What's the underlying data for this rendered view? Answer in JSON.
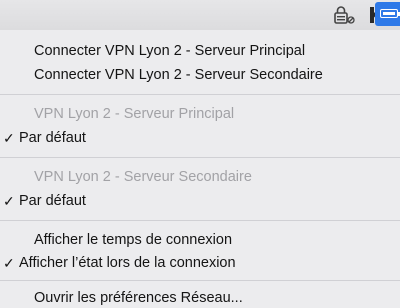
{
  "menubar": {
    "icons": [
      "vpn-lock-icon",
      "k-app-icon",
      "battery-icon"
    ],
    "accent": "#2e79e8"
  },
  "menu": {
    "connect_primary": "Connecter VPN Lyon 2 - Serveur Principal",
    "connect_secondary": "Connecter VPN Lyon 2 - Serveur Secondaire",
    "primary_header": "VPN Lyon 2 - Serveur Principal",
    "primary_default": "Par défaut",
    "secondary_header": "VPN Lyon 2 - Serveur Secondaire",
    "secondary_default": "Par défaut",
    "show_time": "Afficher le temps de connexion",
    "show_status": "Afficher l’état lors de la connexion",
    "open_prefs": "Ouvrir les préférences Réseau...",
    "checkmark": "✓"
  }
}
